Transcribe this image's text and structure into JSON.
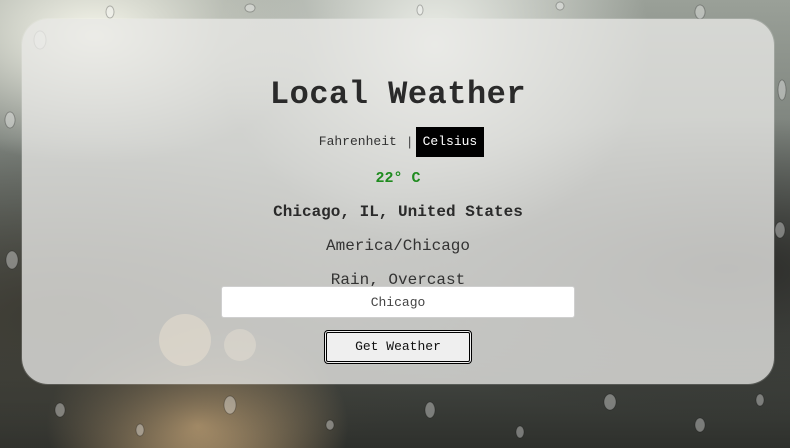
{
  "title": "Local Weather",
  "units": {
    "fahrenheit_label": "Fahrenheit",
    "separator": "|",
    "celsius_label": "Celsius",
    "selected": "Celsius"
  },
  "weather": {
    "temperature": "22° C",
    "location": "Chicago, IL, United States",
    "timezone": "America/Chicago",
    "conditions": "Rain, Overcast"
  },
  "search": {
    "value": "Chicago",
    "button_label": "Get Weather"
  },
  "colors": {
    "temperature": "#1f8b1f",
    "active_unit_bg": "#000000",
    "card_bg": "rgba(232,232,230,0.78)"
  }
}
